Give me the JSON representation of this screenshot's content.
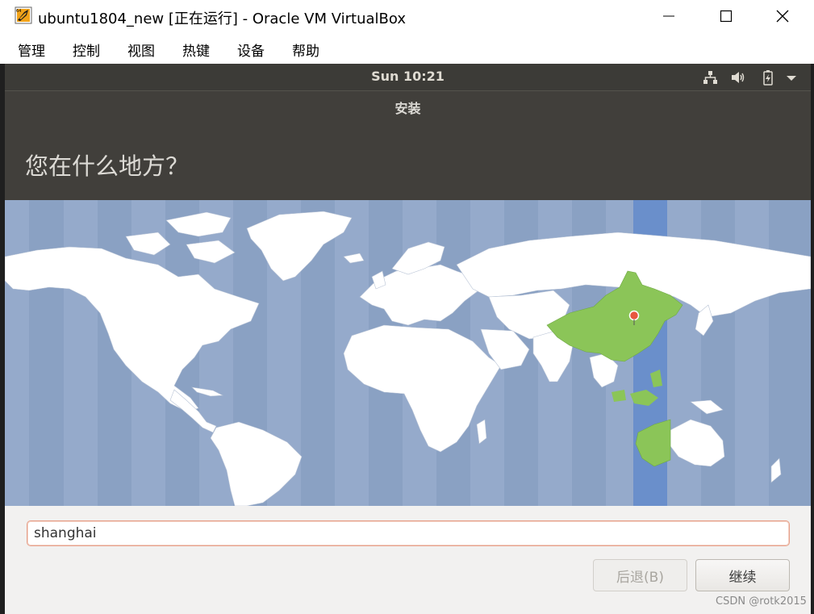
{
  "window": {
    "title": "ubuntu1804_new [正在运行] - Oracle VM VirtualBox",
    "app_icon": "virtualbox-icon",
    "controls": [
      "minimize-icon",
      "maximize-icon",
      "close-icon"
    ]
  },
  "menu": {
    "items": [
      "管理",
      "控制",
      "视图",
      "热键",
      "设备",
      "帮助"
    ]
  },
  "ubuntu": {
    "clock": "Sun 10:21",
    "tray_icons": [
      "network-icon",
      "volume-icon",
      "battery-icon",
      "chevron-down-icon"
    ]
  },
  "installer": {
    "title": "安装",
    "question": "您在什么地方？",
    "location_value": "shanghai",
    "back_label": "后退(B)",
    "continue_label": "继续",
    "selected_region_color": "#8bc558",
    "timezone_band_color": "#6a8fcb"
  },
  "watermark": "CSDN @rotk2015"
}
